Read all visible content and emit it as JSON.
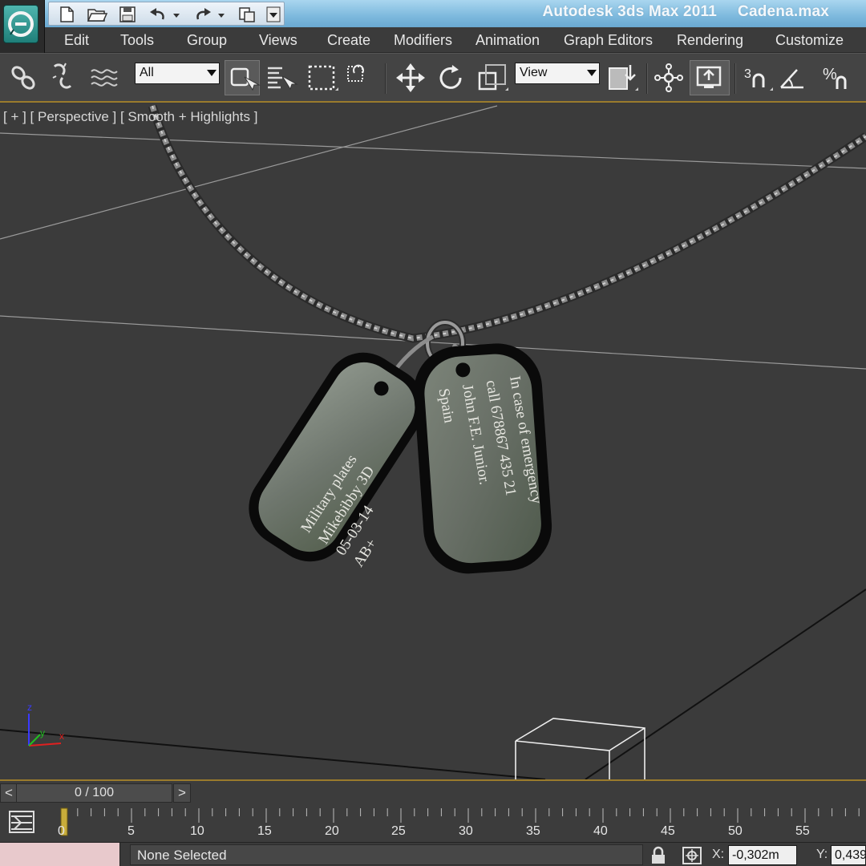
{
  "window": {
    "app_title": "Autodesk 3ds Max  2011",
    "file_name": "Cadena.max"
  },
  "menu": [
    "Edit",
    "Tools",
    "Group",
    "Views",
    "Create",
    "Modifiers",
    "Animation",
    "Graph Editors",
    "Rendering",
    "Customize"
  ],
  "toolbar": {
    "selection_filter": "All",
    "reference_coordinate_system": "View",
    "snap_label": "3"
  },
  "viewport": {
    "label": "[ + ] [ Perspective ] [ Smooth + Highlights ]",
    "tag_left_lines": [
      "Military plates",
      "Mikebibby 3D",
      "05-03-14",
      "AB+"
    ],
    "tag_right_lines": [
      "In case of emergency",
      "call 678867 435 21",
      "John F.E. Junior.",
      "Spain"
    ],
    "axis_labels": {
      "z": "z",
      "y": "y",
      "x": "x"
    }
  },
  "timeline": {
    "slider_text": "0 / 100",
    "prev_label": "<",
    "next_label": ">",
    "ticks": [
      "0",
      "5",
      "10",
      "15",
      "20",
      "25",
      "30",
      "35",
      "40",
      "45",
      "50",
      "55"
    ]
  },
  "status": {
    "selection": "None Selected",
    "x_label": "X:",
    "x_value": "-0,302m",
    "y_label": "Y:",
    "y_value": "0,439"
  },
  "colors": {
    "viewport_bg": "#3b3b3b",
    "accent_gold": "#9a7b2c",
    "title_blue": "#7db9dd"
  }
}
